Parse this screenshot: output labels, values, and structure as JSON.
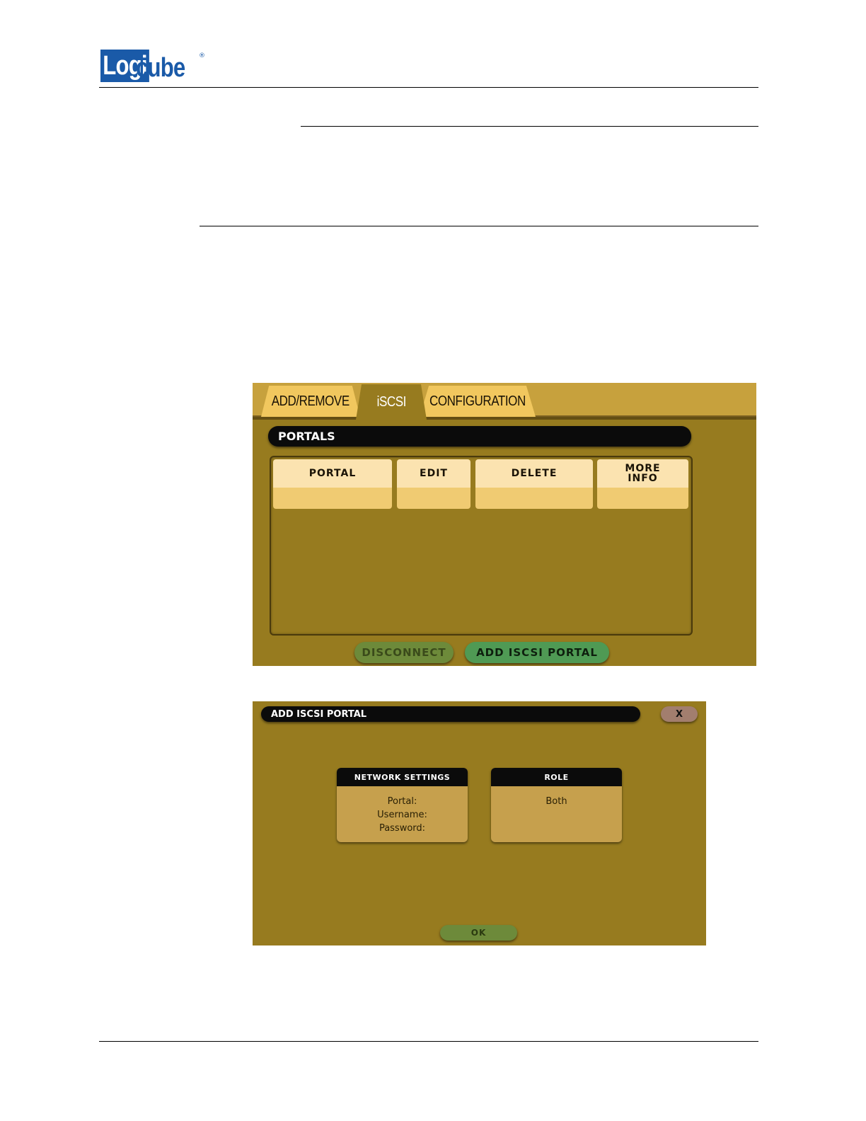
{
  "logo": {
    "text_block": "Logi",
    "text_rest": "cube",
    "registered": "®",
    "color": "#1a5aa8"
  },
  "screen1": {
    "tabs": [
      "ADD/REMOVE",
      "iSCSI",
      "CONFIGURATION"
    ],
    "active_tab": "iSCSI",
    "section_title": "PORTALS",
    "columns": [
      "PORTAL",
      "EDIT",
      "DELETE",
      "MORE INFO"
    ],
    "buttons": {
      "disconnect": "DISCONNECT",
      "add_portal": "ADD ISCSI PORTAL"
    }
  },
  "screen2": {
    "title": "ADD ISCSI PORTAL",
    "close": "X",
    "network_settings": {
      "title": "NETWORK SETTINGS",
      "portal": "Portal:",
      "username": "Username:",
      "password": "Password:"
    },
    "role": {
      "title": "ROLE",
      "value": "Both"
    },
    "ok": "OK"
  },
  "colors": {
    "panel": "#977b1f",
    "tab": "#f1c75e",
    "header": "#0b0b0b",
    "green_button": "#4f9a54"
  }
}
